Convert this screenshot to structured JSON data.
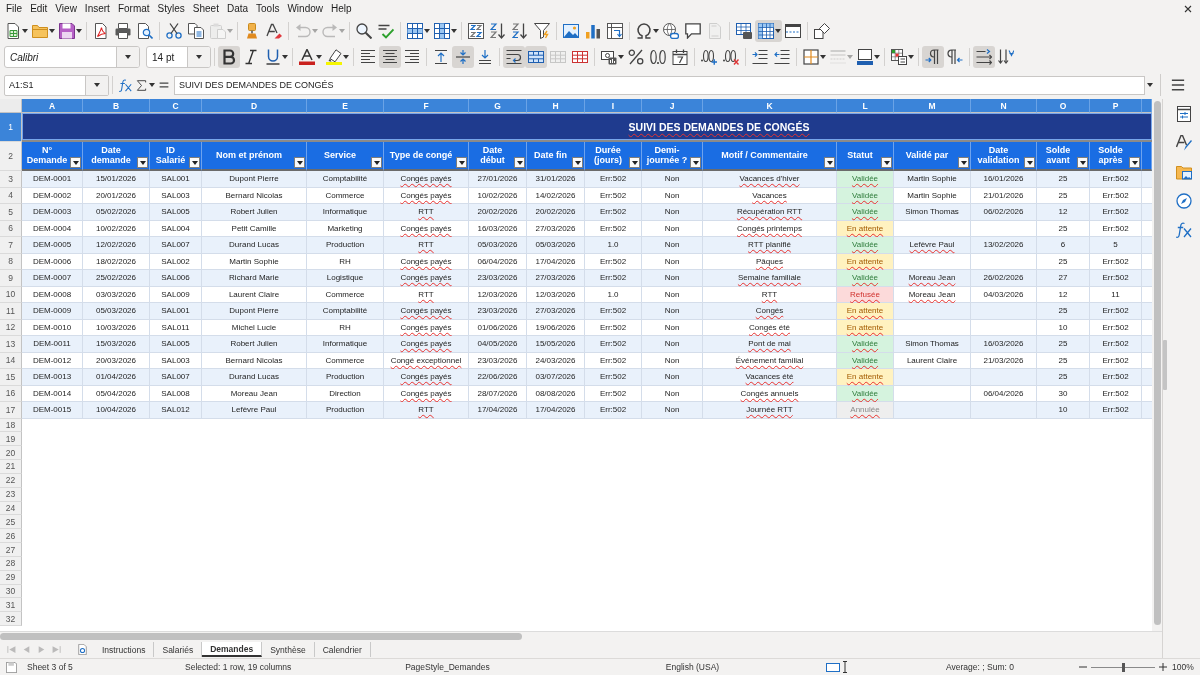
{
  "menu_bar": {
    "items": [
      "File",
      "Edit",
      "View",
      "Insert",
      "Format",
      "Styles",
      "Sheet",
      "Data",
      "Tools",
      "Window",
      "Help"
    ]
  },
  "standard_toolbar": {
    "paste_disabled": true,
    "undo_disabled": true,
    "redo_disabled": true,
    "headers_footers_disabled": true,
    "freeze_rows_columns_on": true
  },
  "formatting_toolbar": {
    "font_name": "Calibri",
    "font_size": "14 pt",
    "bold_on": true,
    "italic_on": false,
    "underline_on": false,
    "align_left_on": false,
    "align_center_on": true,
    "align_right_on": false,
    "align_top_on": false,
    "align_middle_on": true,
    "align_bottom_on": false,
    "wrap_text_on": true,
    "merge_and_center_on": true,
    "merge_cells_disabled": true,
    "border_style_disabled": true,
    "left_to_right_on": true,
    "right_to_left_on": false,
    "text_horizontal_on": true,
    "text_vertical_on": false
  },
  "formula_bar": {
    "name_box": "A1:S1",
    "content": "SUIVI DES DEMANDES DE CONGÉS"
  },
  "sheet": {
    "columns": [
      {
        "letter": "A",
        "selected": true,
        "heading": "N° Demande",
        "cells_spell_marked": false
      },
      {
        "letter": "B",
        "selected": true,
        "heading": "Date demande",
        "cells_spell_marked": false
      },
      {
        "letter": "C",
        "selected": true,
        "heading": "ID Salarié",
        "cells_spell_marked": false
      },
      {
        "letter": "D",
        "selected": true,
        "heading": "Nom et prénom",
        "cells_spell_marked": false
      },
      {
        "letter": "E",
        "selected": true,
        "heading": "Service",
        "cells_spell_marked": false
      },
      {
        "letter": "F",
        "selected": true,
        "heading": "Type de congé",
        "cells_spell_marked": true
      },
      {
        "letter": "G",
        "selected": true,
        "heading": "Date début",
        "cells_spell_marked": false
      },
      {
        "letter": "H",
        "selected": true,
        "heading": "Date fin",
        "cells_spell_marked": false
      },
      {
        "letter": "I",
        "selected": true,
        "heading": "Durée (jours)",
        "cells_spell_marked": false
      },
      {
        "letter": "J",
        "selected": true,
        "heading": "Demi-journée ?",
        "cells_spell_marked": false
      },
      {
        "letter": "K",
        "selected": true,
        "heading": "Motif / Commentaire",
        "cells_spell_marked": true
      },
      {
        "letter": "L",
        "selected": true,
        "heading": "Statut",
        "cells_spell_marked": true
      },
      {
        "letter": "M",
        "selected": true,
        "heading": "Validé par",
        "cells_spell_marked": false
      },
      {
        "letter": "N",
        "selected": true,
        "heading": "Date validation",
        "cells_spell_marked": false
      },
      {
        "letter": "O",
        "selected": true,
        "heading": "Solde avant",
        "cells_spell_marked": false
      },
      {
        "letter": "P",
        "selected": true,
        "heading": "Solde après",
        "cells_spell_marked": false
      }
    ],
    "title_row": {
      "number": "1",
      "selected": true,
      "title": "SUIVI DES DEMANDES DE CONGÉS",
      "title_spell_marked": true
    },
    "header_row": {
      "number": "2",
      "selected": false
    },
    "rows": [
      {
        "number": "3",
        "selected": false,
        "request_no": "DEM-0001",
        "request_date": "15/01/2026",
        "employee_id": "SAL001",
        "employee_name": "Dupont Pierre",
        "department": "Comptabilité",
        "leave_type": "Congés payés",
        "start_date": "27/01/2026",
        "end_date": "31/01/2026",
        "days": "Err:502",
        "half_day": "Non",
        "reason": "Vacances d'hiver",
        "status": {
          "text": "Validée",
          "kind": "validated"
        },
        "validated_by": "Martin Sophie",
        "validated_by_spell_marked": false,
        "validation_date": "16/01/2026",
        "balance_before": "25",
        "balance_after": "Err:502"
      },
      {
        "number": "4",
        "selected": false,
        "request_no": "DEM-0002",
        "request_date": "20/01/2026",
        "employee_id": "SAL003",
        "employee_name": "Bernard Nicolas",
        "department": "Commerce",
        "leave_type": "Congés payés",
        "start_date": "10/02/2026",
        "end_date": "14/02/2026",
        "days": "Err:502",
        "half_day": "Non",
        "reason": "Vacances",
        "status": {
          "text": "Validée",
          "kind": "validated"
        },
        "validated_by": "Martin Sophie",
        "validated_by_spell_marked": false,
        "validation_date": "21/01/2026",
        "balance_before": "25",
        "balance_after": "Err:502"
      },
      {
        "number": "5",
        "selected": false,
        "request_no": "DEM-0003",
        "request_date": "05/02/2026",
        "employee_id": "SAL005",
        "employee_name": "Robert Julien",
        "department": "Informatique",
        "leave_type": "RTT",
        "start_date": "20/02/2026",
        "end_date": "20/02/2026",
        "days": "Err:502",
        "half_day": "Non",
        "reason": "Récupération RTT",
        "status": {
          "text": "Validée",
          "kind": "validated"
        },
        "validated_by": "Simon Thomas",
        "validated_by_spell_marked": false,
        "validation_date": "06/02/2026",
        "balance_before": "12",
        "balance_after": "Err:502"
      },
      {
        "number": "6",
        "selected": false,
        "request_no": "DEM-0004",
        "request_date": "10/02/2026",
        "employee_id": "SAL004",
        "employee_name": "Petit Camille",
        "department": "Marketing",
        "leave_type": "Congés payés",
        "start_date": "16/03/2026",
        "end_date": "27/03/2026",
        "days": "Err:502",
        "half_day": "Non",
        "reason": "Congés printemps",
        "status": {
          "text": "En attente",
          "kind": "pending"
        },
        "balance_before": "25",
        "balance_after": "Err:502"
      },
      {
        "number": "7",
        "selected": false,
        "request_no": "DEM-0005",
        "request_date": "12/02/2026",
        "employee_id": "SAL007",
        "employee_name": "Durand Lucas",
        "department": "Production",
        "leave_type": "RTT",
        "start_date": "05/03/2026",
        "end_date": "05/03/2026",
        "days": "1.0",
        "half_day": "Non",
        "reason": "RTT planifié",
        "status": {
          "text": "Validée",
          "kind": "validated"
        },
        "validated_by": "Lefèvre Paul",
        "validated_by_spell_marked": true,
        "validation_date": "13/02/2026",
        "balance_before": "6",
        "balance_after": "5"
      },
      {
        "number": "8",
        "selected": false,
        "request_no": "DEM-0006",
        "request_date": "18/02/2026",
        "employee_id": "SAL002",
        "employee_name": "Martin Sophie",
        "department": "RH",
        "leave_type": "Congés payés",
        "start_date": "06/04/2026",
        "end_date": "17/04/2026",
        "days": "Err:502",
        "half_day": "Non",
        "reason": "Pâques",
        "status": {
          "text": "En attente",
          "kind": "pending"
        },
        "balance_before": "25",
        "balance_after": "Err:502"
      },
      {
        "number": "9",
        "selected": false,
        "request_no": "DEM-0007",
        "request_date": "25/02/2026",
        "employee_id": "SAL006",
        "employee_name": "Richard Marie",
        "department": "Logistique",
        "leave_type": "Congés payés",
        "start_date": "23/03/2026",
        "end_date": "27/03/2026",
        "days": "Err:502",
        "half_day": "Non",
        "reason": "Semaine familiale",
        "status": {
          "text": "Validée",
          "kind": "validated"
        },
        "validated_by": "Moreau Jean",
        "validated_by_spell_marked": true,
        "validation_date": "26/02/2026",
        "balance_before": "27",
        "balance_after": "Err:502"
      },
      {
        "number": "10",
        "selected": false,
        "request_no": "DEM-0008",
        "request_date": "03/03/2026",
        "employee_id": "SAL009",
        "employee_name": "Laurent Claire",
        "department": "Commerce",
        "leave_type": "RTT",
        "start_date": "12/03/2026",
        "end_date": "12/03/2026",
        "days": "1.0",
        "half_day": "Non",
        "reason": "RTT",
        "status": {
          "text": "Refusée",
          "kind": "refused"
        },
        "validated_by": "Moreau Jean",
        "validated_by_spell_marked": true,
        "validation_date": "04/03/2026",
        "balance_before": "12",
        "balance_after": "11"
      },
      {
        "number": "11",
        "selected": false,
        "request_no": "DEM-0009",
        "request_date": "05/03/2026",
        "employee_id": "SAL001",
        "employee_name": "Dupont Pierre",
        "department": "Comptabilité",
        "leave_type": "Congés payés",
        "start_date": "23/03/2026",
        "end_date": "27/03/2026",
        "days": "Err:502",
        "half_day": "Non",
        "reason": "Congés",
        "status": {
          "text": "En attente",
          "kind": "pending"
        },
        "balance_before": "25",
        "balance_after": "Err:502"
      },
      {
        "number": "12",
        "selected": false,
        "request_no": "DEM-0010",
        "request_date": "10/03/2026",
        "employee_id": "SAL011",
        "employee_name": "Michel Lucie",
        "department": "RH",
        "leave_type": "Congés payés",
        "start_date": "01/06/2026",
        "end_date": "19/06/2026",
        "days": "Err:502",
        "half_day": "Non",
        "reason": "Congés été",
        "status": {
          "text": "En attente",
          "kind": "pending"
        },
        "balance_before": "10",
        "balance_after": "Err:502"
      },
      {
        "number": "13",
        "selected": false,
        "request_no": "DEM-0011",
        "request_date": "15/03/2026",
        "employee_id": "SAL005",
        "employee_name": "Robert Julien",
        "department": "Informatique",
        "leave_type": "Congés payés",
        "start_date": "04/05/2026",
        "end_date": "15/05/2026",
        "days": "Err:502",
        "half_day": "Non",
        "reason": "Pont de mai",
        "status": {
          "text": "Validée",
          "kind": "validated"
        },
        "validated_by": "Simon Thomas",
        "validated_by_spell_marked": false,
        "validation_date": "16/03/2026",
        "balance_before": "25",
        "balance_after": "Err:502"
      },
      {
        "number": "14",
        "selected": false,
        "request_no": "DEM-0012",
        "request_date": "20/03/2026",
        "employee_id": "SAL003",
        "employee_name": "Bernard Nicolas",
        "department": "Commerce",
        "leave_type": "Congé exceptionnel",
        "start_date": "23/03/2026",
        "end_date": "24/03/2026",
        "days": "Err:502",
        "half_day": "Non",
        "reason": "Événement familial",
        "status": {
          "text": "Validée",
          "kind": "validated"
        },
        "validated_by": "Laurent Claire",
        "validated_by_spell_marked": false,
        "validation_date": "21/03/2026",
        "balance_before": "25",
        "balance_after": "Err:502"
      },
      {
        "number": "15",
        "selected": false,
        "request_no": "DEM-0013",
        "request_date": "01/04/2026",
        "employee_id": "SAL007",
        "employee_name": "Durand Lucas",
        "department": "Production",
        "leave_type": "Congés payés",
        "start_date": "22/06/2026",
        "end_date": "03/07/2026",
        "days": "Err:502",
        "half_day": "Non",
        "reason": "Vacances été",
        "status": {
          "text": "En attente",
          "kind": "pending"
        },
        "balance_before": "25",
        "balance_after": "Err:502"
      },
      {
        "number": "16",
        "selected": false,
        "request_no": "DEM-0014",
        "request_date": "05/04/2026",
        "employee_id": "SAL008",
        "employee_name": "Moreau Jean",
        "department": "Direction",
        "leave_type": "Congés payés",
        "start_date": "28/07/2026",
        "end_date": "08/08/2026",
        "days": "Err:502",
        "half_day": "Non",
        "reason": "Congés annuels",
        "status": {
          "text": "Validée",
          "kind": "validated"
        },
        "validation_date": "06/04/2026",
        "balance_before": "30",
        "balance_after": "Err:502"
      },
      {
        "number": "17",
        "selected": false,
        "request_no": "DEM-0015",
        "request_date": "10/04/2026",
        "employee_id": "SAL012",
        "employee_name": "Lefèvre Paul",
        "department": "Production",
        "leave_type": "RTT",
        "start_date": "17/04/2026",
        "end_date": "17/04/2026",
        "days": "Err:502",
        "half_day": "Non",
        "reason": "Journée RTT",
        "status": {
          "text": "Annulée",
          "kind": "cancelled"
        },
        "balance_before": "10",
        "balance_after": "Err:502"
      }
    ],
    "empty_rows": [
      {
        "number": "18",
        "selected": false
      },
      {
        "number": "19",
        "selected": false
      },
      {
        "number": "20",
        "selected": false
      },
      {
        "number": "21",
        "selected": false
      },
      {
        "number": "22",
        "selected": false
      },
      {
        "number": "23",
        "selected": false
      },
      {
        "number": "24",
        "selected": false
      },
      {
        "number": "25",
        "selected": false
      },
      {
        "number": "26",
        "selected": false
      },
      {
        "number": "27",
        "selected": false
      },
      {
        "number": "28",
        "selected": false
      },
      {
        "number": "29",
        "selected": false
      },
      {
        "number": "30",
        "selected": false
      },
      {
        "number": "31",
        "selected": false
      },
      {
        "number": "32",
        "selected": false
      }
    ]
  },
  "sheet_tab_bar": {
    "scroll_buttons_disabled": true,
    "tabs": [
      {
        "label": "Instructions",
        "selected": false
      },
      {
        "label": "Salariés",
        "selected": false
      },
      {
        "label": "Demandes",
        "selected": true
      },
      {
        "label": "Synthèse",
        "selected": false
      },
      {
        "label": "Calendrier",
        "selected": false
      }
    ]
  },
  "status_bar": {
    "sheet": "Sheet 3 of 5",
    "selection": "Selected: 1 row, 19 columns",
    "page_style": "PageStyle_Demandes",
    "language": "English (USA)",
    "statistics": "Average: ; Sum: 0",
    "zoom": {
      "level": 0.5,
      "reading": "100%"
    }
  }
}
